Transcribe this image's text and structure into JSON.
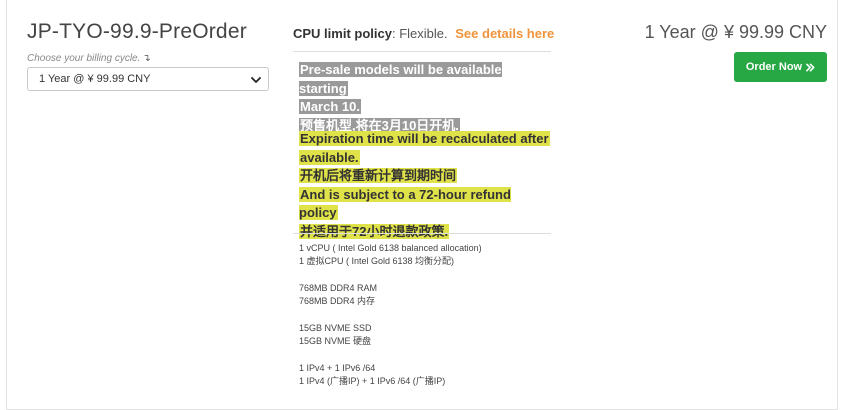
{
  "product": {
    "title": "JP-TYO-99.9-PreOrder",
    "billing_hint": "Choose your billing cycle.",
    "billing_selected": "1 Year @ ¥ 99.99 CNY"
  },
  "policy": {
    "label": "CPU limit policy",
    "sep": ":",
    "value": "Flexible.",
    "link": "See details here"
  },
  "notice_grey": [
    "Pre-sale models will be available starting",
    "March 10.",
    "预售机型,将在3月10日开机."
  ],
  "notice_yellow": [
    "Expiration time will be recalculated after",
    "available.",
    "开机后将重新计算到期时间",
    "And is subject to a 72-hour refund policy",
    "并适用于72小时退款政策."
  ],
  "specs": [
    [
      "1 vCPU ( Intel Gold 6138 balanced allocation)",
      "1 虚拟CPU ( Intel Gold 6138 均衡分配)"
    ],
    [
      "768MB DDR4 RAM",
      "768MB DDR4 内存"
    ],
    [
      "15GB NVME SSD",
      "15GB NVME 硬盘"
    ],
    [
      "1 IPv4 + 1 IPv6 /64",
      "1 IPv4 (广播IP) + 1 IPv6 /64 (广播IP)"
    ]
  ],
  "pricing": {
    "display": "1 Year @ ¥ 99.99 CNY",
    "order_label": "Order Now"
  },
  "colors": {
    "order_button": "#27a844",
    "link": "#f0933a",
    "highlight_grey": "#9a9a9a",
    "highlight_yellow": "#e0e24a"
  },
  "icons": [
    "arrow-down-right-icon",
    "chevron-down-icon",
    "double-chevron-right-icon"
  ]
}
